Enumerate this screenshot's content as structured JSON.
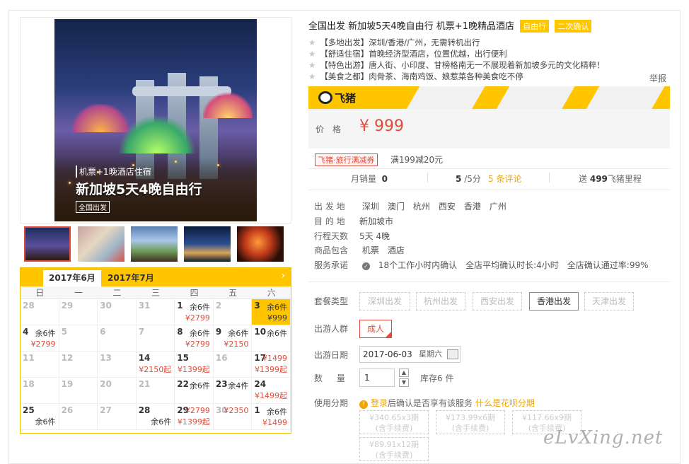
{
  "product": {
    "title": "全国出发 新加坡5天4晚自由行 机票+1晚精品酒店",
    "badges": [
      "自由行",
      "二次确认"
    ],
    "features": [
      "【多地出发】深圳/香港/广州，无需转机出行",
      "【舒适住宿】首晚经济型酒店，位置优越，出行便利",
      "【特色出游】唐人街、小印度、甘榜格南无一不展现着新加坡多元的文化精粹！",
      "【美食之都】肉骨茶、海南鸡饭、娘惹菜各种美食吃不停"
    ],
    "report": "举报"
  },
  "hero": {
    "sub": "机票+1晚酒店住宿",
    "main": "新加坡5天4晚自由行",
    "tag": "全国出发"
  },
  "brand": {
    "name": "飞猪"
  },
  "price": {
    "label": "价格",
    "value": "¥ 999"
  },
  "coupon": {
    "tag": "飞猪·旅行满减券",
    "text": "满199减20元"
  },
  "stats": {
    "monthly_label": "月销量",
    "monthly": "0",
    "score": "5",
    "score_suffix": "/5分",
    "reviews": "5 条评论",
    "miles_pre": "送",
    "miles": "499",
    "miles_suf": "飞猪里程"
  },
  "info": {
    "depart_label": "出 发 地",
    "depart": [
      "深圳",
      "澳门",
      "杭州",
      "西安",
      "香港",
      "广州"
    ],
    "dest_label": "目 的 地",
    "dest": "新加坡市",
    "days_label": "行程天数",
    "days": "5天 4晚",
    "incl_label": "商品包含",
    "incl": [
      "机票",
      "酒店"
    ],
    "promise_label": "服务承诺",
    "promise": [
      "18个工作小时内确认",
      "全店平均确认时长:4小时",
      "全店确认通过率:99%"
    ]
  },
  "options": {
    "package_label": "套餐类型",
    "packages": [
      "深圳出发",
      "杭州出发",
      "西安出发",
      "香港出发",
      "天津出发"
    ],
    "selected_package": "香港出发",
    "crowd_label": "出游人群",
    "crowd": "成人",
    "date_label": "出游日期",
    "date": "2017-06-03",
    "weekday": "星期六",
    "qty_label": "数 量",
    "qty": "1",
    "stock": "库存6 件",
    "installment_label": "使用分期",
    "notice_login": "登录",
    "notice_mid": "后确认是否享有该服务",
    "notice_link": "什么是花呗分期",
    "installments": [
      {
        "amt": "¥340.65x3期",
        "fee": "(含手续费)"
      },
      {
        "amt": "¥173.99x6期",
        "fee": "(含手续费)"
      },
      {
        "amt": "¥117.66x9期",
        "fee": "(含手续费)"
      },
      {
        "amt": "¥89.91x12期",
        "fee": "(含手续费)"
      }
    ]
  },
  "calendar": {
    "tabs": [
      "2017年6月",
      "2017年7月"
    ],
    "weekdays": [
      "日",
      "一",
      "二",
      "三",
      "四",
      "五",
      "六"
    ],
    "cells": [
      {
        "d": "28",
        "g": true
      },
      {
        "d": "29",
        "g": true
      },
      {
        "d": "30",
        "g": true
      },
      {
        "d": "31",
        "g": true
      },
      {
        "d": "1",
        "s": "余6件",
        "p": "¥2799"
      },
      {
        "d": "2",
        "g": true
      },
      {
        "d": "3",
        "s": "余6件",
        "p": "¥999",
        "sel": true
      },
      {
        "d": "4",
        "s": "余6件",
        "p": "¥2799"
      },
      {
        "d": "5",
        "g": true
      },
      {
        "d": "6",
        "g": true
      },
      {
        "d": "7",
        "g": true
      },
      {
        "d": "8",
        "s": "余6件",
        "p": "¥2799"
      },
      {
        "d": "9",
        "s": "余6件",
        "p": "¥2150"
      },
      {
        "d": "10",
        "s": "余6件"
      },
      {
        "d": "11",
        "g": true
      },
      {
        "d": "12",
        "g": true
      },
      {
        "d": "13",
        "g": true
      },
      {
        "d": "14",
        "p": "¥2150起"
      },
      {
        "d": "15",
        "p": "¥1399起"
      },
      {
        "d": "16",
        "g": true
      },
      {
        "d": "17",
        "s": "¥1499",
        "p": "¥1399起"
      },
      {
        "d": "18",
        "g": true
      },
      {
        "d": "19",
        "g": true
      },
      {
        "d": "20",
        "g": true
      },
      {
        "d": "21",
        "g": true
      },
      {
        "d": "22",
        "s": "余6件"
      },
      {
        "d": "23",
        "s": "余4件"
      },
      {
        "d": "24",
        "p": "¥1499起"
      },
      {
        "d": "25",
        "p": "余6件"
      },
      {
        "d": "26",
        "g": true
      },
      {
        "d": "27",
        "g": true
      },
      {
        "d": "28",
        "p": "余6件"
      },
      {
        "d": "29",
        "s": "¥2799",
        "p": "¥1399起"
      },
      {
        "d": "30",
        "g": true,
        "s": "¥2350"
      },
      {
        "d": "1",
        "s": "余6件",
        "p": "¥1499"
      }
    ]
  },
  "watermark": "eLvXing.net",
  "colors": {
    "accent": "#ffc600",
    "price": "#e14b3b"
  }
}
